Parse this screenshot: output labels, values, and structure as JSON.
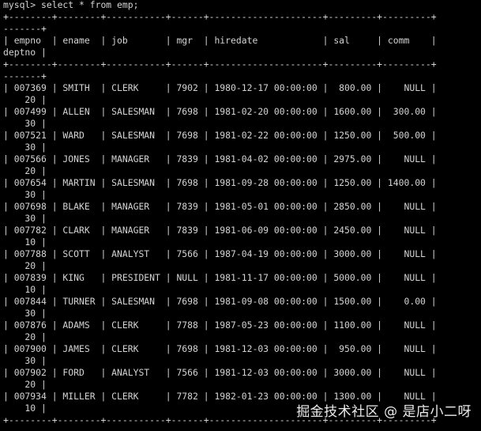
{
  "terminal": {
    "background": "#000000",
    "foreground": "#d4d4d4",
    "lines": [
      "mysql> select * from emp;",
      "+--------+--------+-----------+------+---------------------+---------+---------+",
      "-------+",
      "| empno  | ename  | job       | mgr  | hiredate            | sal     | comm    |",
      "deptno |",
      "+--------+--------+-----------+------+---------------------+---------+---------+",
      "-------+",
      "| 007369 | SMITH  | CLERK     | 7902 | 1980-12-17 00:00:00 |  800.00 |    NULL |",
      "    20 |",
      "| 007499 | ALLEN  | SALESMAN  | 7698 | 1981-02-20 00:00:00 | 1600.00 |  300.00 |",
      "    30 |",
      "| 007521 | WARD   | SALESMAN  | 7698 | 1981-02-22 00:00:00 | 1250.00 |  500.00 |",
      "    30 |",
      "| 007566 | JONES  | MANAGER   | 7839 | 1981-04-02 00:00:00 | 2975.00 |    NULL |",
      "    20 |",
      "| 007654 | MARTIN | SALESMAN  | 7698 | 1981-09-28 00:00:00 | 1250.00 | 1400.00 |",
      "    30 |",
      "| 007698 | BLAKE  | MANAGER   | 7839 | 1981-05-01 00:00:00 | 2850.00 |    NULL |",
      "    30 |",
      "| 007782 | CLARK  | MANAGER   | 7839 | 1981-06-09 00:00:00 | 2450.00 |    NULL |",
      "    10 |",
      "| 007788 | SCOTT  | ANALYST   | 7566 | 1987-04-19 00:00:00 | 3000.00 |    NULL |",
      "    20 |",
      "| 007839 | KING   | PRESIDENT | NULL | 1981-11-17 00:00:00 | 5000.00 |    NULL |",
      "    10 |",
      "| 007844 | TURNER | SALESMAN  | 7698 | 1981-09-08 00:00:00 | 1500.00 |    0.00 |",
      "    30 |",
      "| 007876 | ADAMS  | CLERK     | 7788 | 1987-05-23 00:00:00 | 1100.00 |    NULL |",
      "    20 |",
      "| 007900 | JAMES  | CLERK     | 7698 | 1981-12-03 00:00:00 |  950.00 |    NULL |",
      "    30 |",
      "| 007902 | FORD   | ANALYST   | 7566 | 1981-12-03 00:00:00 | 3000.00 |    NULL |",
      "    20 |",
      "| 007934 | MILLER | CLERK     | 7782 | 1982-01-23 00:00:00 | 1300.00 |    NULL |",
      "    10 |",
      "+--------+--------+-----------+------+---------------------+---------+---------+"
    ]
  },
  "watermark": {
    "text": "掘金技术社区 @ 是店小二呀"
  }
}
